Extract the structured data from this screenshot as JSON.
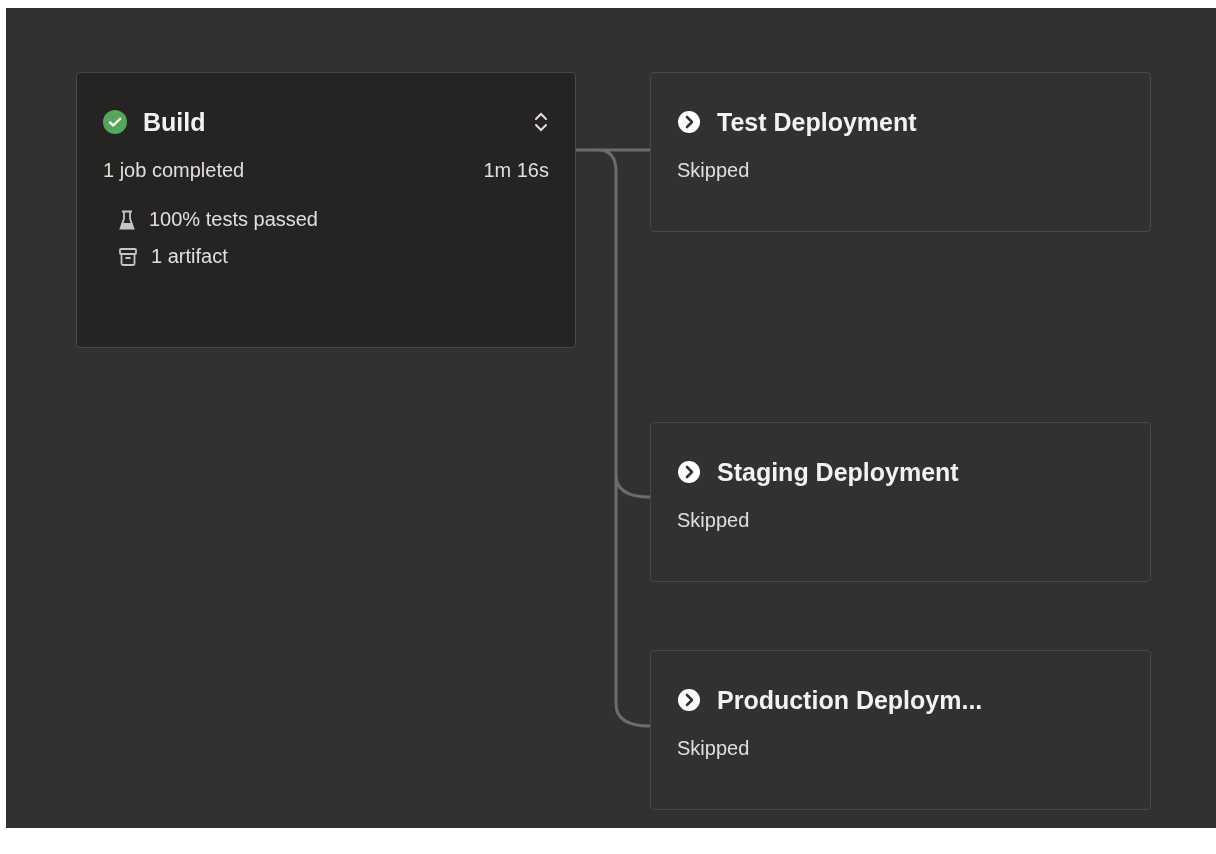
{
  "build": {
    "title": "Build",
    "kind": "succeeded",
    "expandable": true,
    "summary": "1 job completed",
    "duration": "1m 16s",
    "details": [
      {
        "kind": "tests",
        "text": "100% tests passed"
      },
      {
        "kind": "artifact",
        "text": "1 artifact"
      }
    ]
  },
  "stages": [
    {
      "title": "Test Deployment",
      "kind": "skipped",
      "state": "Skipped"
    },
    {
      "title": "Staging Deployment",
      "kind": "skipped",
      "state": "Skipped"
    },
    {
      "title": "Production Deploym...",
      "kind": "skipped",
      "state": "Skipped"
    }
  ]
}
